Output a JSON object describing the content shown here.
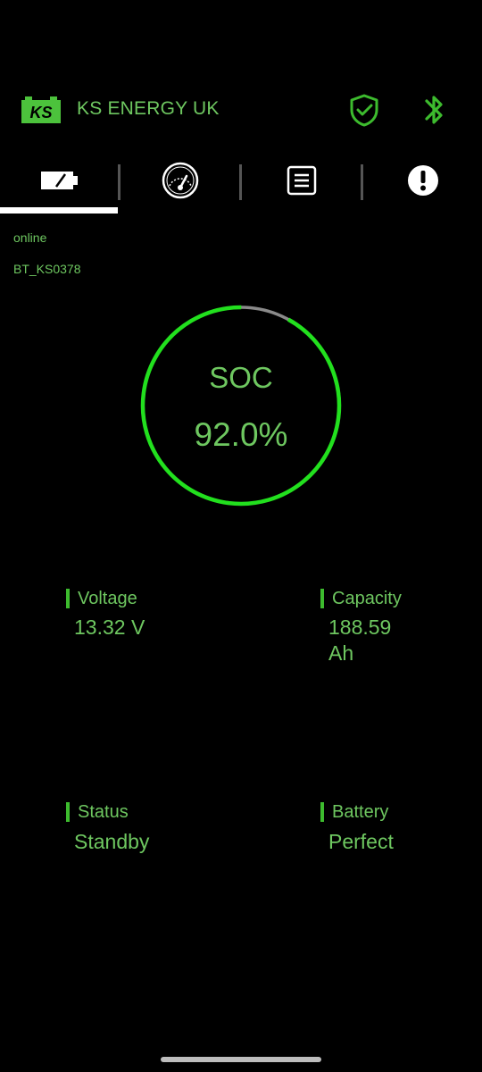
{
  "header": {
    "logo_text": "KS",
    "brand": "KS ENERGY UK",
    "icons": [
      "battery-logo-icon",
      "shield-check-icon",
      "bluetooth-icon"
    ]
  },
  "tabs": [
    {
      "name": "battery-tab",
      "icon": "battery-icon",
      "selected": true
    },
    {
      "name": "gauge-tab",
      "icon": "speedometer-icon",
      "selected": false
    },
    {
      "name": "log-tab",
      "icon": "document-icon",
      "selected": false
    },
    {
      "name": "alert-tab",
      "icon": "alert-icon",
      "selected": false
    }
  ],
  "connection": {
    "status": "online",
    "device_id": "BT_KS0378"
  },
  "soc": {
    "label": "SOC",
    "value_text": "92.0%",
    "fraction": 0.92,
    "ring_color": "#22e01e",
    "remainder_color": "#8a8a8a"
  },
  "metrics": {
    "voltage": {
      "title": "Voltage",
      "value": "13.32 V"
    },
    "capacity": {
      "title": "Capacity",
      "value_line1": "188.59",
      "value_line2": "Ah"
    },
    "status": {
      "title": "Status",
      "value": "Standby"
    },
    "battery": {
      "title": "Battery",
      "value": "Perfect"
    }
  },
  "colors": {
    "accent_text": "#6ec760",
    "accent_bar": "#3dbb2e",
    "background": "#000000",
    "tab_indicator": "#ffffff"
  }
}
